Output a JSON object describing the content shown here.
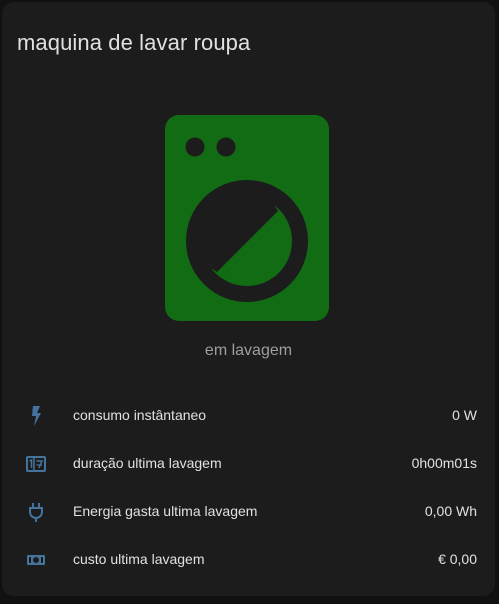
{
  "card": {
    "title": "maquina de lavar roupa",
    "state": "em lavagem",
    "icon": "washing-machine-icon",
    "icon_color": "#126c14"
  },
  "entities": [
    {
      "icon": "flash-icon",
      "label": "consumo instântaneo",
      "value": "0 W"
    },
    {
      "icon": "timer-icon",
      "label": "duração ultima lavagem",
      "value": "0h00m01s"
    },
    {
      "icon": "power-plug-icon",
      "label": "Energia gasta ultima lavagem",
      "value": "0,00 Wh"
    },
    {
      "icon": "cash-icon",
      "label": "custo ultima lavagem",
      "value": "€ 0,00"
    }
  ],
  "colors": {
    "background": "#111111",
    "card": "#1c1c1c",
    "primary_text": "#e1e1e1",
    "secondary_text": "#9e9e9e",
    "icon": "#44739e"
  }
}
